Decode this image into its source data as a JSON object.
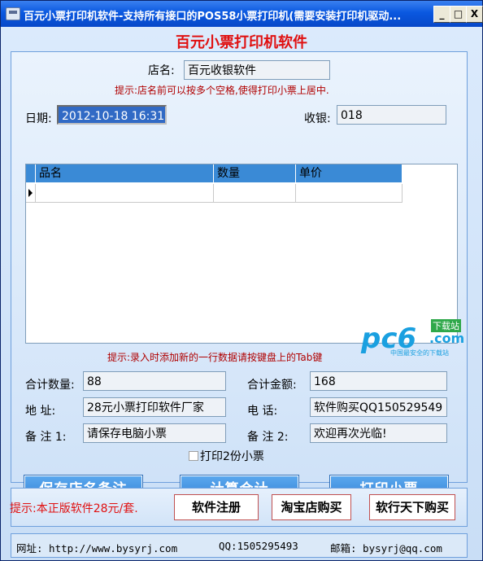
{
  "window": {
    "title": "百元小票打印机软件-支持所有接口的POS58小票打印机(需要安装打印机驱动...",
    "min_label": "_",
    "max_label": "□",
    "close_label": "X"
  },
  "heading": "百元小票打印机软件",
  "store": {
    "label": "店名:",
    "value": "百元收银软件",
    "hint": "提示:店名前可以按多个空格,使得打印小票上居中."
  },
  "date": {
    "label": "日期:",
    "value": "2012-10-18 16:31"
  },
  "cashier": {
    "label": "收银:",
    "value": "018"
  },
  "grid": {
    "columns": [
      "品名",
      "数量",
      "单价"
    ]
  },
  "grid_hint": "提示:录入时添加新的一行数据请按键盘上的Tab键",
  "totals": {
    "qty_label": "合计数量:",
    "qty_value": "88",
    "amount_label": "合计金额:",
    "amount_value": "168"
  },
  "address": {
    "label": "地   址:",
    "value": "28元小票打印软件厂家"
  },
  "phone": {
    "label": "电   话:",
    "value": "软件购买QQ150529549"
  },
  "note1": {
    "label": "备  注 1:",
    "value": "请保存电脑小票"
  },
  "note2": {
    "label": "备  注 2:",
    "value": "欢迎再次光临!"
  },
  "print_twice_label": "打印2份小票",
  "buttons": {
    "save": "保存店名备注",
    "calc": "计算合计",
    "print": "打印小票"
  },
  "bottom": {
    "hint": "提示:本正版软件28元/套.",
    "register": "软件注册",
    "taobao": "淘宝店购买",
    "tianxia": "软行天下购买"
  },
  "footer": {
    "website": "网址: http://www.bysyrj.com",
    "qq": "QQ:1505295493",
    "email": "邮箱: bysyrj@qq.com"
  },
  "watermark": {
    "brand": "pc6",
    "sub": "下载站",
    "domain": ".com",
    "tagline": "中国最安全的下载站"
  },
  "colors": {
    "heading": "#e01010",
    "hint": "#b00000",
    "button": "#2f7fd4",
    "titlebar": "#0a58e0"
  }
}
